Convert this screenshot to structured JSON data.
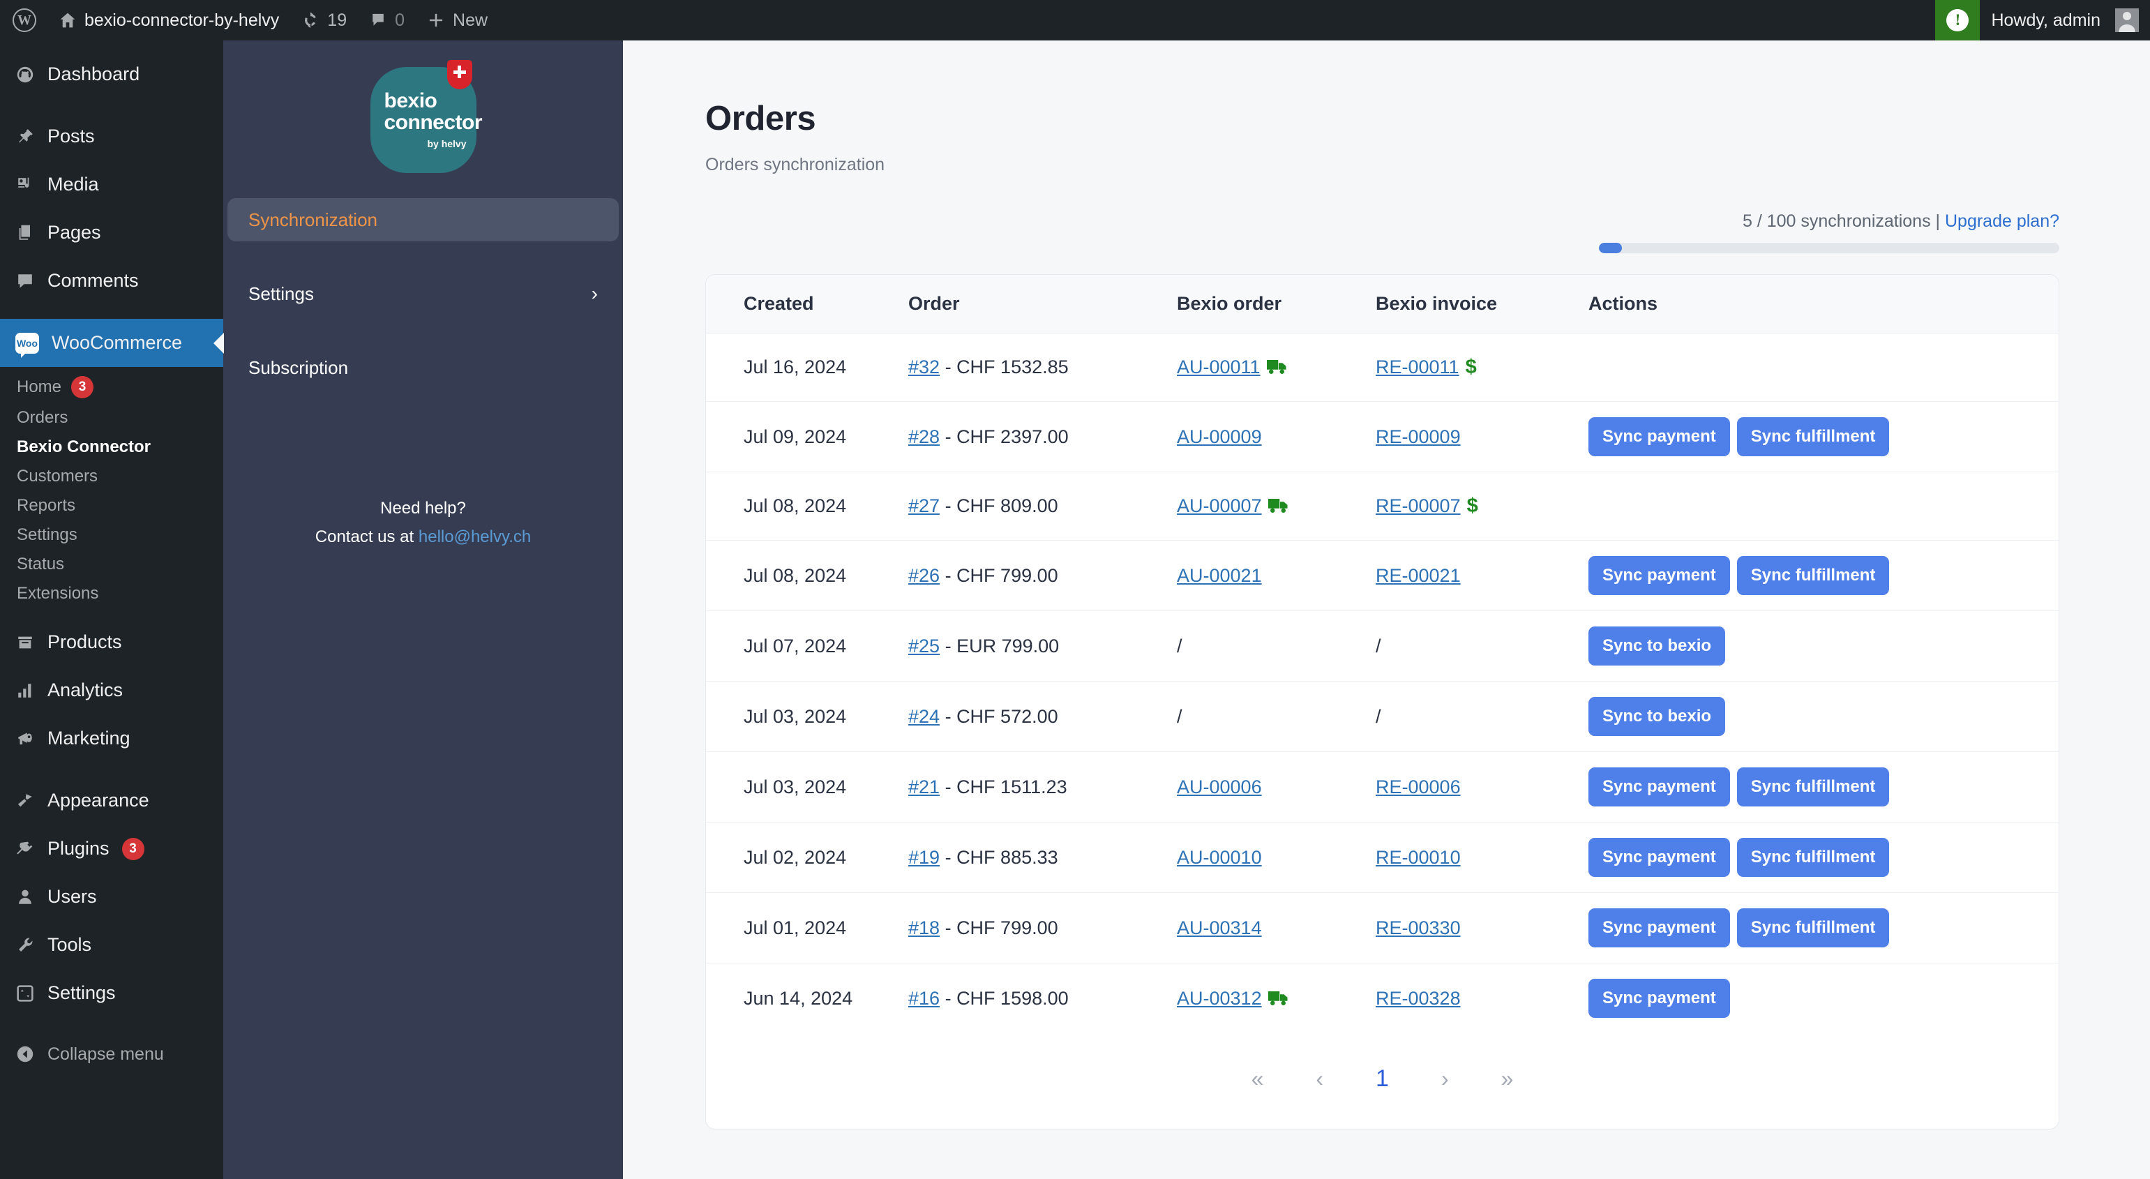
{
  "adminbar": {
    "wp_logo_icon": "wordpress-icon",
    "site_home_icon": "home-icon",
    "site_name": "bexio-connector-by-helvy",
    "updates_icon": "updates-icon",
    "updates_count": "19",
    "comments_icon": "comment-icon",
    "comments_count": "0",
    "new_icon": "plus-icon",
    "new_label": "New",
    "notice_icon": "exclamation-icon",
    "howdy": "Howdy, admin",
    "avatar_icon": "avatar-icon"
  },
  "wpmenu": {
    "items": [
      {
        "label": "Dashboard",
        "icon": "dashboard-icon",
        "active": false
      },
      {
        "label": "Posts",
        "icon": "pin-icon",
        "active": false
      },
      {
        "label": "Media",
        "icon": "media-icon",
        "active": false
      },
      {
        "label": "Pages",
        "icon": "pages-icon",
        "active": false
      },
      {
        "label": "Comments",
        "icon": "comment-icon",
        "active": false
      },
      {
        "label": "WooCommerce",
        "icon": "woocommerce-icon",
        "active": true
      },
      {
        "label": "Products",
        "icon": "products-icon",
        "active": false
      },
      {
        "label": "Analytics",
        "icon": "analytics-icon",
        "active": false
      },
      {
        "label": "Marketing",
        "icon": "marketing-icon",
        "active": false
      },
      {
        "label": "Appearance",
        "icon": "appearance-icon",
        "active": false
      },
      {
        "label": "Plugins",
        "icon": "plugins-icon",
        "active": false,
        "badge": "3"
      },
      {
        "label": "Users",
        "icon": "users-icon",
        "active": false
      },
      {
        "label": "Tools",
        "icon": "tools-icon",
        "active": false
      },
      {
        "label": "Settings",
        "icon": "settings-icon",
        "active": false
      }
    ],
    "submenu": [
      {
        "label": "Home",
        "badge": "3",
        "current": false
      },
      {
        "label": "Orders",
        "current": false
      },
      {
        "label": "Bexio Connector",
        "current": true
      },
      {
        "label": "Customers",
        "current": false
      },
      {
        "label": "Reports",
        "current": false
      },
      {
        "label": "Settings",
        "current": false
      },
      {
        "label": "Status",
        "current": false
      },
      {
        "label": "Extensions",
        "current": false
      }
    ],
    "collapse_label": "Collapse menu",
    "collapse_icon": "collapse-arrow-icon"
  },
  "plugin_panel": {
    "logo": {
      "line1": "bexio",
      "line2": "connector",
      "line3": "by helvy",
      "badge_icon": "swiss-cross-icon",
      "bg_color": "#2d7781"
    },
    "nav": [
      {
        "label": "Synchronization",
        "active": true,
        "chevron": false
      },
      {
        "label": "Settings",
        "active": false,
        "chevron": true
      },
      {
        "label": "Subscription",
        "active": false,
        "chevron": false
      }
    ],
    "chevron_icon": "chevron-right-icon",
    "help_title": "Need help?",
    "help_text": "Contact us at",
    "help_email": "hello@helvy.ch",
    "active_color": "#ef9446"
  },
  "main": {
    "title": "Orders",
    "subtitle": "Orders synchronization",
    "quota": {
      "text": "5 / 100 synchronizations | ",
      "upgrade_label": "Upgrade plan?",
      "used": 5,
      "total": 100,
      "percent": 5,
      "bar_color": "#4a7fe0"
    },
    "table": {
      "columns": [
        "Created",
        "Order",
        "Bexio order",
        "Bexio invoice",
        "Actions"
      ],
      "rows": [
        {
          "created": "Jul 16, 2024",
          "order_id": "#32",
          "order_sep": " - ",
          "order_amount": "CHF 1532.85",
          "bexio_order": "AU-00011",
          "bexio_order_truck": true,
          "bexio_invoice": "RE-00011",
          "bexio_invoice_paid": true,
          "actions": []
        },
        {
          "created": "Jul 09, 2024",
          "order_id": "#28",
          "order_sep": " - ",
          "order_amount": "CHF 2397.00",
          "bexio_order": "AU-00009",
          "bexio_order_truck": false,
          "bexio_invoice": "RE-00009",
          "bexio_invoice_paid": false,
          "actions": [
            "Sync payment",
            "Sync fulfillment"
          ]
        },
        {
          "created": "Jul 08, 2024",
          "order_id": "#27",
          "order_sep": " - ",
          "order_amount": "CHF 809.00",
          "bexio_order": "AU-00007",
          "bexio_order_truck": true,
          "bexio_invoice": "RE-00007",
          "bexio_invoice_paid": true,
          "actions": []
        },
        {
          "created": "Jul 08, 2024",
          "order_id": "#26",
          "order_sep": " - ",
          "order_amount": "CHF 799.00",
          "bexio_order": "AU-00021",
          "bexio_order_truck": false,
          "bexio_invoice": "RE-00021",
          "bexio_invoice_paid": false,
          "actions": [
            "Sync payment",
            "Sync fulfillment"
          ]
        },
        {
          "created": "Jul 07, 2024",
          "order_id": "#25",
          "order_sep": " - ",
          "order_amount": "EUR 799.00",
          "bexio_order": "/",
          "bexio_order_truck": false,
          "bexio_invoice": "/",
          "bexio_invoice_paid": false,
          "actions": [
            "Sync to bexio"
          ]
        },
        {
          "created": "Jul 03, 2024",
          "order_id": "#24",
          "order_sep": " - ",
          "order_amount": "CHF 572.00",
          "bexio_order": "/",
          "bexio_order_truck": false,
          "bexio_invoice": "/",
          "bexio_invoice_paid": false,
          "actions": [
            "Sync to bexio"
          ]
        },
        {
          "created": "Jul 03, 2024",
          "order_id": "#21",
          "order_sep": " - ",
          "order_amount": "CHF 1511.23",
          "bexio_order": "AU-00006",
          "bexio_order_truck": false,
          "bexio_invoice": "RE-00006",
          "bexio_invoice_paid": false,
          "actions": [
            "Sync payment",
            "Sync fulfillment"
          ]
        },
        {
          "created": "Jul 02, 2024",
          "order_id": "#19",
          "order_sep": " - ",
          "order_amount": "CHF 885.33",
          "bexio_order": "AU-00010",
          "bexio_order_truck": false,
          "bexio_invoice": "RE-00010",
          "bexio_invoice_paid": false,
          "actions": [
            "Sync payment",
            "Sync fulfillment"
          ]
        },
        {
          "created": "Jul 01, 2024",
          "order_id": "#18",
          "order_sep": " - ",
          "order_amount": "CHF 799.00",
          "bexio_order": "AU-00314",
          "bexio_order_truck": false,
          "bexio_invoice": "RE-00330",
          "bexio_invoice_paid": false,
          "actions": [
            "Sync payment",
            "Sync fulfillment"
          ]
        },
        {
          "created": "Jun 14, 2024",
          "order_id": "#16",
          "order_sep": " - ",
          "order_amount": "CHF 1598.00",
          "bexio_order": "AU-00312",
          "bexio_order_truck": true,
          "bexio_invoice": "RE-00328",
          "bexio_invoice_paid": false,
          "actions": [
            "Sync payment"
          ]
        }
      ]
    },
    "pagination": {
      "first": "«",
      "prev": "‹",
      "current": "1",
      "next": "›",
      "last": "»"
    },
    "icons": {
      "truck": "truck-icon",
      "paid": "dollar-icon"
    },
    "link_color": "#2d72b5",
    "button_color": "#4f7fe8",
    "truck_color": "#1f8a1f"
  }
}
